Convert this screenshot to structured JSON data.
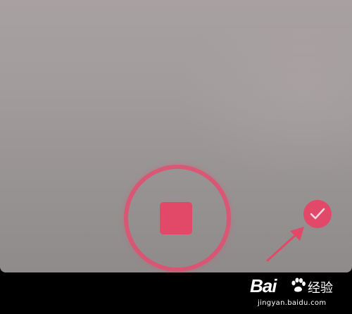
{
  "camera": {
    "state": "recording",
    "stop_button_icon": "stop-square-icon",
    "confirm_button_icon": "checkmark-icon"
  },
  "annotation": {
    "arrow_icon": "arrow-icon",
    "points_to": "confirm-button"
  },
  "watermark": {
    "brand": "Bai",
    "product": "经验",
    "domain": "jingyan.baidu.com"
  },
  "colors": {
    "accent": "#e24868",
    "preview_background": "#a19b9b",
    "bar_background": "#000000"
  }
}
